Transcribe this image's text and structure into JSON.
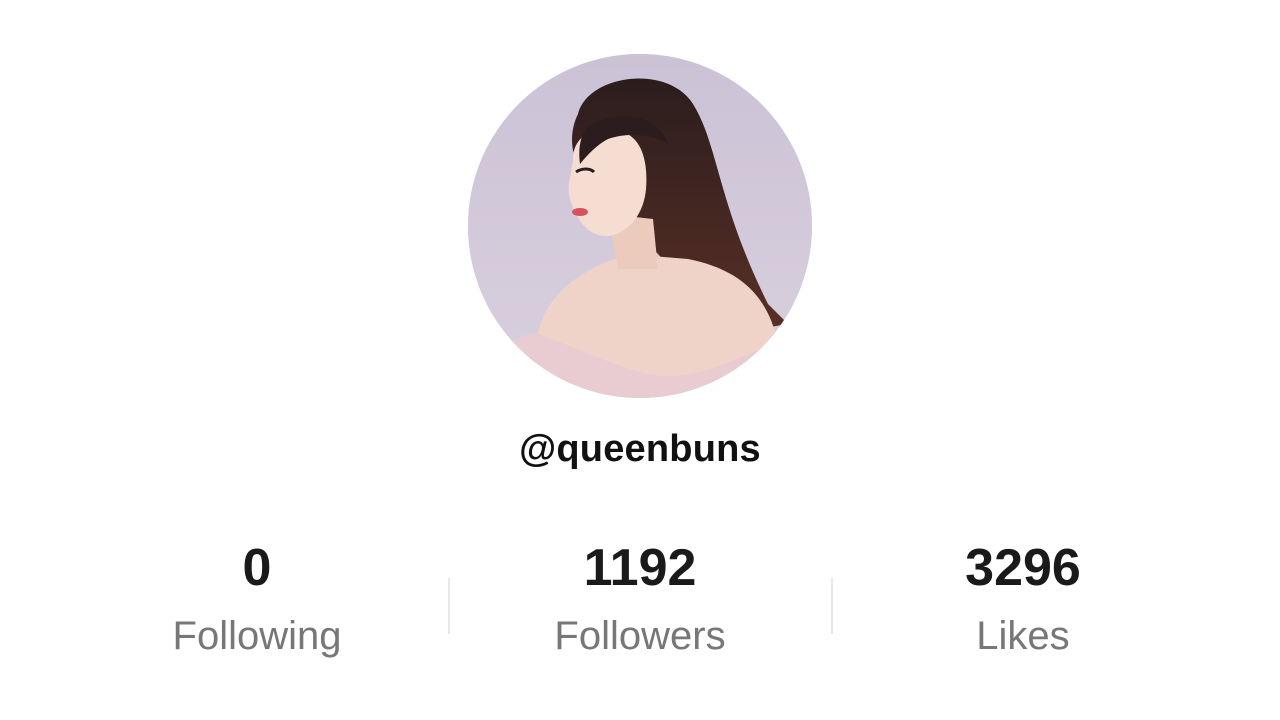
{
  "profile": {
    "username": "@queenbuns",
    "avatar_icon": "profile-photo"
  },
  "stats": [
    {
      "count": "0",
      "label": "Following"
    },
    {
      "count": "1192",
      "label": "Followers"
    },
    {
      "count": "3296",
      "label": "Likes"
    }
  ],
  "colors": {
    "avatar_background": "#cfc6d8",
    "count_text": "#1a1a1a",
    "label_text": "#777777",
    "divider": "#e8e8e8"
  }
}
